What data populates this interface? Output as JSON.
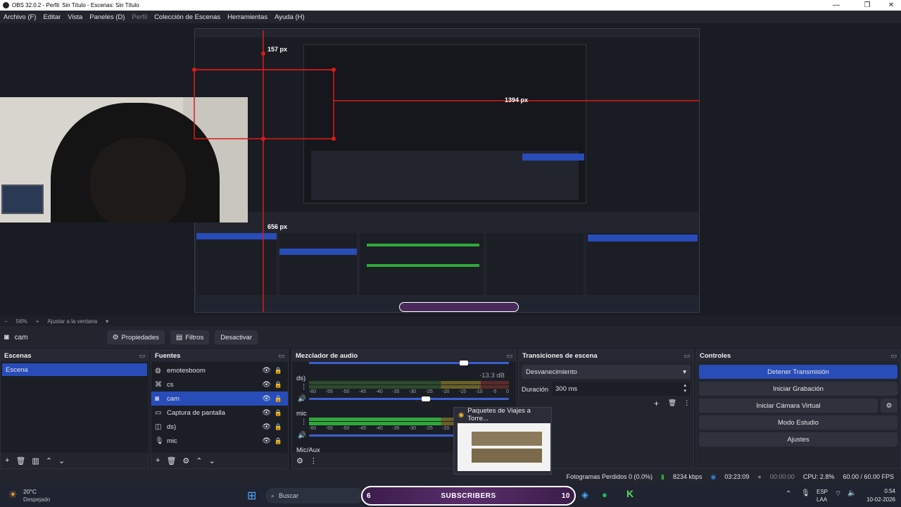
{
  "window": {
    "title": "OBS 32.0.2 - Perfil: Sin Título - Escenas: Sin Título",
    "controls": [
      "—",
      "❐",
      "✕"
    ]
  },
  "menu": [
    {
      "label": "Archivo (F)",
      "enabled": true
    },
    {
      "label": "Editar",
      "enabled": true
    },
    {
      "label": "Vista",
      "enabled": true
    },
    {
      "label": "Paneles (D)",
      "enabled": true
    },
    {
      "label": "Perfil",
      "enabled": false
    },
    {
      "label": "Colección de Escenas",
      "enabled": true
    },
    {
      "label": "Herramientas",
      "enabled": true
    },
    {
      "label": "Ayuda (H)",
      "enabled": true
    }
  ],
  "preview": {
    "measure_top": "157 px",
    "measure_right": "1394 px",
    "measure_bottom": "656 px"
  },
  "zoom": {
    "minus": "−",
    "value": "56%",
    "plus": "+",
    "fit_label": "Ajustar a la ventana"
  },
  "toolbar": {
    "source_name": "cam",
    "properties_label": "Propiedades",
    "filters_label": "Filtros",
    "deactivate_label": "Desactivar"
  },
  "scenes": {
    "title": "Escenas",
    "items": [
      "Escena"
    ]
  },
  "sources": {
    "title": "Fuentes",
    "items": [
      {
        "name": "emotesboom",
        "icon": "globe-icon"
      },
      {
        "name": "cs",
        "icon": "gamepad-icon"
      },
      {
        "name": "cam",
        "icon": "camera-icon"
      },
      {
        "name": "Captura de pantalla",
        "icon": "monitor-icon"
      },
      {
        "name": "ds)",
        "icon": "audio-output-icon"
      },
      {
        "name": "mic",
        "icon": "microphone-icon"
      }
    ]
  },
  "mixer": {
    "title": "Mezclador de audio",
    "channels": [
      {
        "name": "ds)",
        "db": "-13.3 dB"
      },
      {
        "name": "mic",
        "db": ""
      }
    ],
    "scale": [
      "-60",
      "-55",
      "-50",
      "-45",
      "-40",
      "-35",
      "-30",
      "-25",
      "-20",
      "-15",
      "-10",
      "-5",
      "0"
    ],
    "mic_aux": "Mic/Aux"
  },
  "transitions": {
    "title": "Transiciones de escena",
    "selected": "Desvanecimiento",
    "duration_label": "Duración",
    "duration_value": "300 ms"
  },
  "controls": {
    "title": "Controles",
    "stop_stream": "Detener Transmisión",
    "start_recording": "Iniciar Grabación",
    "start_virtual_cam": "Iniciar Cámara Virtual",
    "studio_mode": "Modo Estudio",
    "settings": "Ajustes"
  },
  "popup": {
    "title": "Paquetes de Viajes a Torre..."
  },
  "status": {
    "dropped": "Fotogramas Perdidos 0 (0.0%)",
    "bitrate": "8234 kbps",
    "stream_time": "03:23:09",
    "rec_time": "00:00:00",
    "cpu": "CPU: 2.8%",
    "fps": "60.00 / 60.00 FPS"
  },
  "taskbar": {
    "weather_temp": "20°C",
    "weather_desc": "Despejado",
    "search_placeholder": "Buscar",
    "overlay_left": "6",
    "overlay_text": "SUBSCRIBERS",
    "overlay_right": "10",
    "lang_top": "ESP",
    "lang_bottom": "LAA",
    "time": "0:54",
    "date": "10-02-2026"
  },
  "colors": {
    "accent": "#284cb8",
    "meter_green": "#2fa83a",
    "meter_yellow": "#a89a2a",
    "meter_red": "#8a2a2a",
    "guide_red": "#e01818"
  }
}
